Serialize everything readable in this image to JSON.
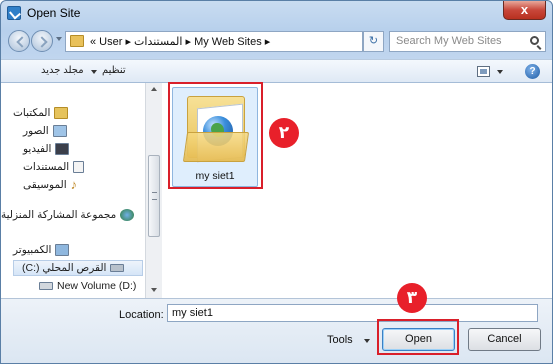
{
  "window": {
    "title": "Open Site",
    "close_label": "x"
  },
  "address_bar": {
    "path_text": "« User ▸ المستندات ▸ My Web Sites ▸",
    "refresh_glyph": "↻"
  },
  "search": {
    "placeholder": "Search My Web Sites"
  },
  "toolbar": {
    "new_folder_label": "مجلد جديد",
    "organize_label": "تنظيم",
    "help_glyph": "?"
  },
  "nav_pane": {
    "items": [
      {
        "label": "المكتبات",
        "icon": "libraries-icon"
      },
      {
        "label": "الصور",
        "icon": "pictures-icon"
      },
      {
        "label": "الفيديو",
        "icon": "videos-icon"
      },
      {
        "label": "المستندات",
        "icon": "documents-icon"
      },
      {
        "label": "الموسيقى",
        "icon": "music-icon"
      },
      {
        "label": "مجموعة المشاركة المنزلية",
        "icon": "homegroup-icon"
      },
      {
        "label": "الكمبيوتر",
        "icon": "computer-icon"
      },
      {
        "label": "(C:) القرص المحلي",
        "icon": "local-disk-icon"
      },
      {
        "label": "New Volume (D:)",
        "icon": "drive-icon"
      }
    ]
  },
  "content": {
    "items": [
      {
        "label": "my siet1",
        "icon": "web-site-folder-icon"
      }
    ]
  },
  "bottom": {
    "location_label": "Location:",
    "location_value": "my siet1",
    "tools_label": "Tools",
    "open_label": "Open",
    "cancel_label": "Cancel"
  },
  "annotations": {
    "marker_2": "٢",
    "marker_3": "٣",
    "highlight_color": "#d91f2a"
  },
  "colors": {
    "window_frame": "#b7d0ec",
    "close_button": "#c8473a",
    "selection": "#dfeefd"
  }
}
